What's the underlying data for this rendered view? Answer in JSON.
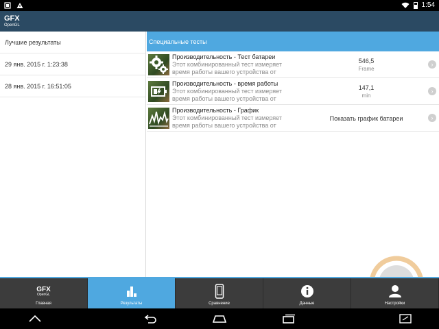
{
  "statusbar": {
    "time": "1:54",
    "icons": [
      "app-notification-icon",
      "warning-icon",
      "wifi-icon",
      "battery-icon"
    ]
  },
  "appbar": {
    "logo_main": "GFX",
    "logo_sub": "OpenGL"
  },
  "left_panel": {
    "header": "Лучшие результаты",
    "items": [
      {
        "label": "29 янв. 2015 г. 1:23:38"
      },
      {
        "label": "28 янв. 2015 г. 16:51:05"
      }
    ]
  },
  "right_panel": {
    "header": "Специальные тесты",
    "rows": [
      {
        "title": "Производительность - Тест батареи",
        "desc_line1": "Этот комбинированный тест измеряет",
        "desc_line2": "время работы вашего устройства от",
        "value": "546,5",
        "unit": "Frame",
        "icon": "gears-icon"
      },
      {
        "title": "Производительность - время работы",
        "desc_line1": "Этот комбинированный тест измеряет",
        "desc_line2": "время работы вашего устройства от",
        "value": "147,1",
        "unit": "min",
        "icon": "battery-charging-icon"
      },
      {
        "title": "Производительность - График",
        "desc_line1": "Этот комбинированный тест измеряет",
        "desc_line2": "время работы вашего устройства от",
        "value": "Показать график батареи",
        "unit": "",
        "icon": "graph-icon"
      }
    ]
  },
  "tabs": [
    {
      "label": "Главная",
      "logo_main": "GFX",
      "logo_sub": "OpenGL",
      "active": false
    },
    {
      "label": "Результаты",
      "active": true
    },
    {
      "label": "Сравнение",
      "active": false
    },
    {
      "label": "Данные",
      "active": false
    },
    {
      "label": "Настройки",
      "active": false
    }
  ],
  "colors": {
    "appbar": "#2b4a63",
    "accent": "#4fa8e0",
    "tabbar": "#3c3c3c"
  }
}
